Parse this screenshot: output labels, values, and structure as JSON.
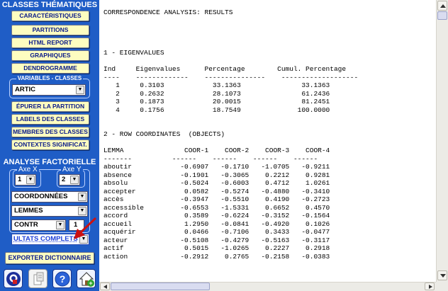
{
  "sidebar": {
    "section_thematic": "CLASSES THÉMATIQUES",
    "buttons_top": [
      "CARACTÉRISTIQUES",
      "PARTITIONS",
      "HTML REPORT",
      "GRAPHIQUES",
      "DENDROGRAMME"
    ],
    "variables_title": "VARIABLES - CLASSES",
    "variables_select": "ARTIC",
    "buttons_mid": [
      "ÉPURER LA PARTITION",
      "LABELS DES CLASSES",
      "MEMBRES DES CLASSES",
      "CONTEXTES SIGNIFICAT."
    ],
    "section_factorial": "ANALYSE FACTORIELLE",
    "axis_x_label": "Axe X",
    "axis_y_label": "Axe Y",
    "axis_x_value": "1",
    "axis_y_value": "2",
    "select_coord": "COORDONNÉES",
    "select_lemmes": "LEMMES",
    "select_contr": "CONTR",
    "contr_value": "1",
    "select_results": "ULTATS COMPLETS",
    "export_button": "EXPORTER DICTIONNAIRE"
  },
  "icons": [
    "q-logo-icon",
    "document-icon",
    "help-icon",
    "home-icon"
  ],
  "colors": {
    "panel": "#1f5dc6",
    "button": "#fdfdc0",
    "button_text": "#0a1a8a",
    "arrow": "#cc1111"
  },
  "results": {
    "title": "CORRESPONDENCE ANALYSIS: RESULTS",
    "sec1_title": "1 - EIGENVALUES",
    "eig_headers": [
      "Ind",
      "Eigenvalues",
      "Percentage",
      "Cumul. Percentage"
    ],
    "eig_rows": [
      [
        "1",
        "0.3103",
        "33.1363",
        "33.1363"
      ],
      [
        "2",
        "0.2632",
        "28.1073",
        "61.2436"
      ],
      [
        "3",
        "0.1873",
        "20.0015",
        "81.2451"
      ],
      [
        "4",
        "0.1756",
        "18.7549",
        "100.0000"
      ]
    ],
    "sec2_title": "2 - ROW COORDINATES  (OBJECTS)",
    "coord_headers": [
      "LEMMA",
      "COOR-1",
      "COOR-2",
      "COOR-3",
      "COOR-4"
    ],
    "coord_rows": [
      [
        "aboutir",
        "-0.6907",
        "-0.1710",
        "-1.0705",
        "-0.9211"
      ],
      [
        "absence",
        "-0.1901",
        "-0.3065",
        "0.2212",
        "0.9281"
      ],
      [
        "absolu",
        "-0.5024",
        "-0.6003",
        "0.4712",
        "1.0261"
      ],
      [
        "accepter",
        "0.0582",
        "-0.5274",
        "-0.4880",
        "-0.3410"
      ],
      [
        "accès",
        "-0.3947",
        "-0.5510",
        "0.4190",
        "-0.2723"
      ],
      [
        "accessible",
        "-0.6553",
        "-1.5331",
        "0.6652",
        "0.4570"
      ],
      [
        "accord",
        "0.3589",
        "-0.6224",
        "-0.3152",
        "-0.1564"
      ],
      [
        "accueil",
        "1.2950",
        "-0.0841",
        "-0.4920",
        "0.1026"
      ],
      [
        "acquérir",
        "0.0466",
        "-0.7106",
        "0.3433",
        "-0.0477"
      ],
      [
        "acteur",
        "-0.5108",
        "-0.4279",
        "-0.5163",
        "-0.3117"
      ],
      [
        "actif",
        "0.5015",
        "-1.0265",
        "0.2227",
        "0.2918"
      ],
      [
        "action",
        "-0.2912",
        "0.2765",
        "-0.2158",
        "-0.0383"
      ]
    ]
  }
}
